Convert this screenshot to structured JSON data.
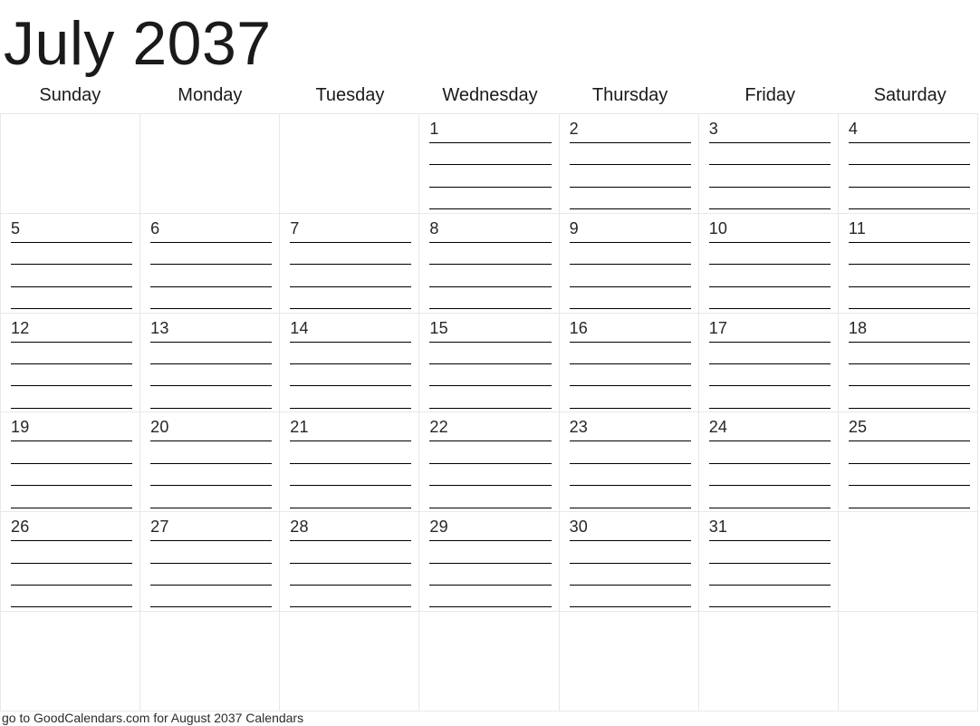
{
  "calendar": {
    "month_title": "July 2037",
    "month": "July",
    "year": "2037",
    "weekdays": [
      "Sunday",
      "Monday",
      "Tuesday",
      "Wednesday",
      "Thursday",
      "Friday",
      "Saturday"
    ],
    "lines_per_day": 4,
    "weeks": [
      [
        "",
        "",
        "",
        "1",
        "2",
        "3",
        "4"
      ],
      [
        "5",
        "6",
        "7",
        "8",
        "9",
        "10",
        "11"
      ],
      [
        "12",
        "13",
        "14",
        "15",
        "16",
        "17",
        "18"
      ],
      [
        "19",
        "20",
        "21",
        "22",
        "23",
        "24",
        "25"
      ],
      [
        "26",
        "27",
        "28",
        "29",
        "30",
        "31",
        ""
      ],
      [
        "",
        "",
        "",
        "",
        "",
        "",
        ""
      ]
    ],
    "footer_note": "go to GoodCalendars.com for August 2037 Calendars",
    "colors": {
      "background": "#ffffff",
      "grid_line": "#e8e8e8",
      "rule_line": "#000000",
      "title_text": "#1a1a1a",
      "day_number_text": "#262626",
      "footer_text": "#2b2b2b"
    }
  }
}
